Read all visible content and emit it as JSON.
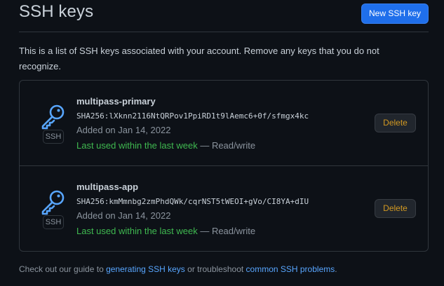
{
  "header": {
    "title": "SSH keys",
    "new_key_label": "New SSH key"
  },
  "description": "This is a list of SSH keys associated with your account. Remove any keys that you do not recognize.",
  "keys": [
    {
      "title": "multipass-primary",
      "fingerprint": "SHA256:lXknn2116NtQRPov1PpiRD1t9lAemc6+0f/sfmgx4kc",
      "added": "Added on Jan 14, 2022",
      "last_used": "Last used within the last week",
      "access": " — Read/write",
      "badge": "SSH",
      "delete_label": "Delete",
      "icon": "key-icon"
    },
    {
      "title": "multipass-app",
      "fingerprint": "SHA256:kmMmnbg2zmPhdQWk/cqrNST5tWEOI+gVo/CI8YA+dIU",
      "added": "Added on Jan 14, 2022",
      "last_used": "Last used within the last week",
      "access": " — Read/write",
      "badge": "SSH",
      "delete_label": "Delete",
      "icon": "key-icon"
    }
  ],
  "footer": {
    "prefix": "Check out our guide to ",
    "link1": "generating SSH keys",
    "middle": " or troubleshoot ",
    "link2": "common SSH problems",
    "suffix": "."
  },
  "colors": {
    "background": "#0d1117",
    "primary_button": "#1f6feb",
    "link": "#58a6ff",
    "success": "#3fb950",
    "danger_text": "#d29922",
    "border": "#30363d"
  }
}
